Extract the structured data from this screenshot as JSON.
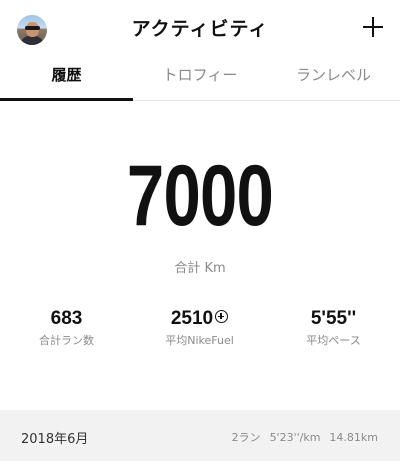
{
  "header": {
    "title": "アクティビティ",
    "add_icon": "plus-icon",
    "avatar": "user-avatar"
  },
  "tabs": [
    {
      "label": "履歴",
      "active": true
    },
    {
      "label": "トロフィー",
      "active": false
    },
    {
      "label": "ランレベル",
      "active": false
    }
  ],
  "totals": {
    "distance_value": "7000",
    "distance_label": "合計 Km"
  },
  "stats": [
    {
      "value": "683",
      "label": "合計ラン数"
    },
    {
      "value": "2510",
      "label": "平均NikeFuel",
      "icon": "nikefuel-icon"
    },
    {
      "value": "5'55''",
      "label": "平均ペース"
    }
  ],
  "month_summary": {
    "month": "2018年6月",
    "runs": "2ラン",
    "pace": "5'23''/km",
    "distance": "14.81km"
  },
  "colors": {
    "text_primary": "#111111",
    "text_secondary": "#8a8a8a",
    "row_background": "#f2f2f2",
    "divider": "#e3e3e3"
  }
}
